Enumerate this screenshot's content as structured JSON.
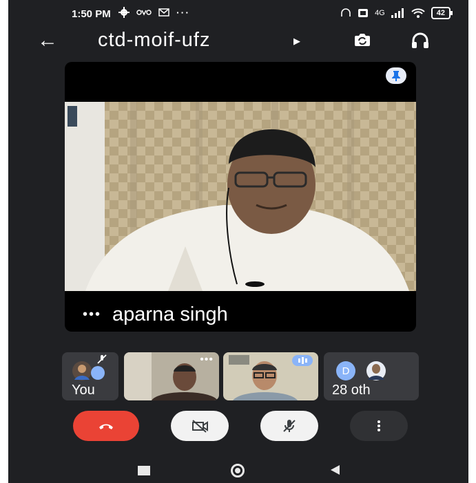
{
  "status_bar": {
    "time": "1:50 PM",
    "network": "4G",
    "battery": "42"
  },
  "header": {
    "meeting_code": "ctd-moif-ufz"
  },
  "main_tile": {
    "participant_name": "aparna singh",
    "more_dots": "•••"
  },
  "thumbnails": [
    {
      "label": "You",
      "mic": "muted"
    },
    {
      "label": ""
    },
    {
      "label": ""
    },
    {
      "avatar_letter": "D",
      "label": "28 oth"
    }
  ],
  "colors": {
    "background": "#1f2023",
    "hangup": "#ea4335",
    "button_light": "#f2f2f2",
    "button_dark": "#303134",
    "avatar_d": "#8ab4f8"
  },
  "icons": [
    "back-arrow-icon",
    "switch-camera-icon",
    "headphones-icon",
    "pin-icon",
    "phone-hangup-icon",
    "camera-off-icon",
    "mic-off-icon",
    "more-vert-icon"
  ]
}
